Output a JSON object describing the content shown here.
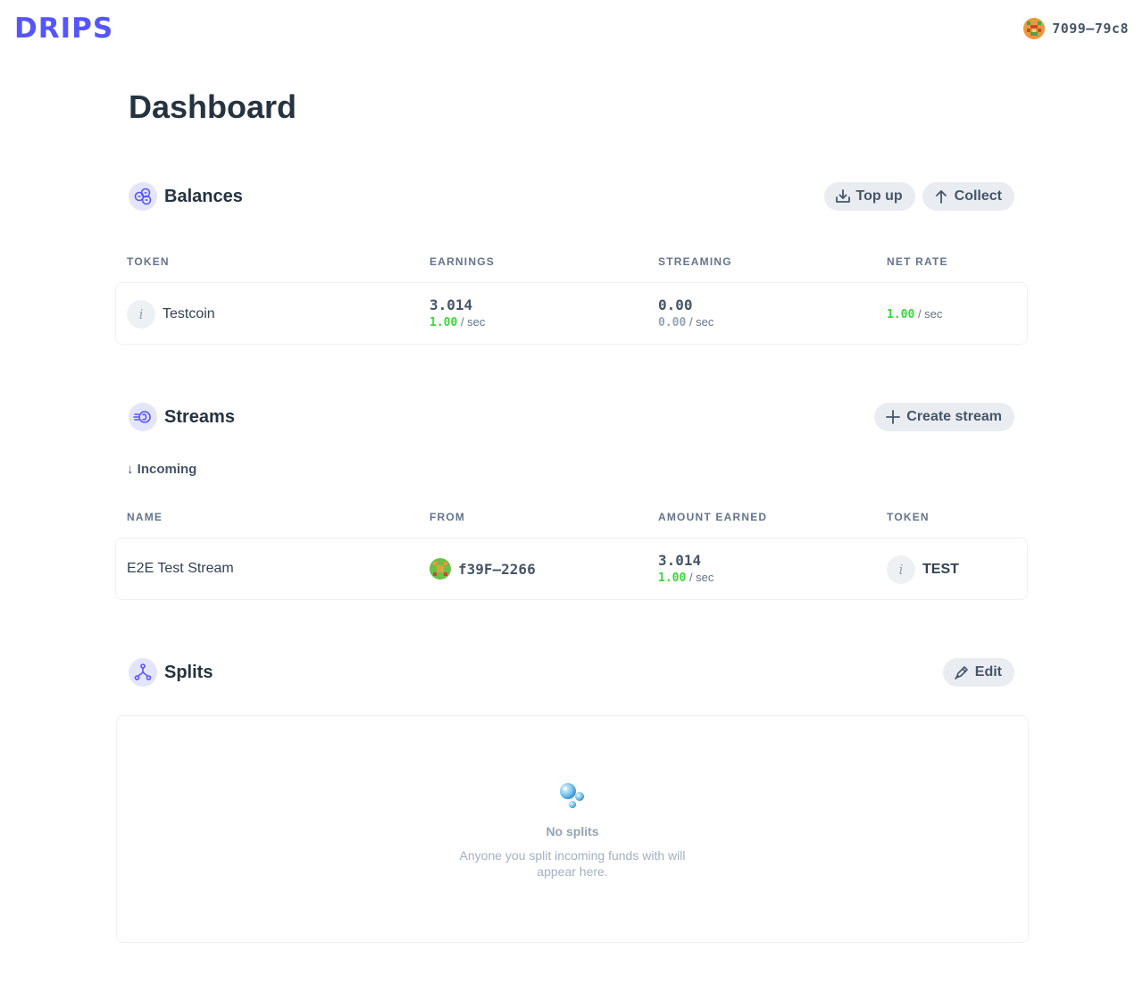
{
  "header": {
    "logo": "DRIPS",
    "account_label": "7099—79c8"
  },
  "page": {
    "title": "Dashboard"
  },
  "balances": {
    "title": "Balances",
    "topup_label": "Top up",
    "collect_label": "Collect",
    "columns": [
      "TOKEN",
      "EARNINGS",
      "STREAMING",
      "NET RATE"
    ],
    "row": {
      "token": "Testcoin",
      "earnings": "3.014",
      "earnings_rate": "1.00",
      "streaming": "0.00",
      "streaming_rate": "0.00",
      "net_rate": "1.00",
      "rate_unit": "/ sec"
    }
  },
  "streams": {
    "title": "Streams",
    "create_label": "Create stream",
    "incoming_label": "↓ Incoming",
    "columns": [
      "NAME",
      "FROM",
      "AMOUNT EARNED",
      "TOKEN"
    ],
    "row": {
      "name": "E2E Test Stream",
      "from": "f39F—2266",
      "amount": "3.014",
      "amount_rate": "1.00",
      "rate_unit": "/ sec",
      "token": "TEST"
    }
  },
  "splits": {
    "title": "Splits",
    "edit_label": "Edit",
    "empty_title": "No splits",
    "empty_desc": "Anyone you split incoming funds with will appear here."
  },
  "colors": {
    "brand": "#5555ff",
    "positive_rate": "#39d839",
    "icon_bg": "#e4e4ff"
  }
}
